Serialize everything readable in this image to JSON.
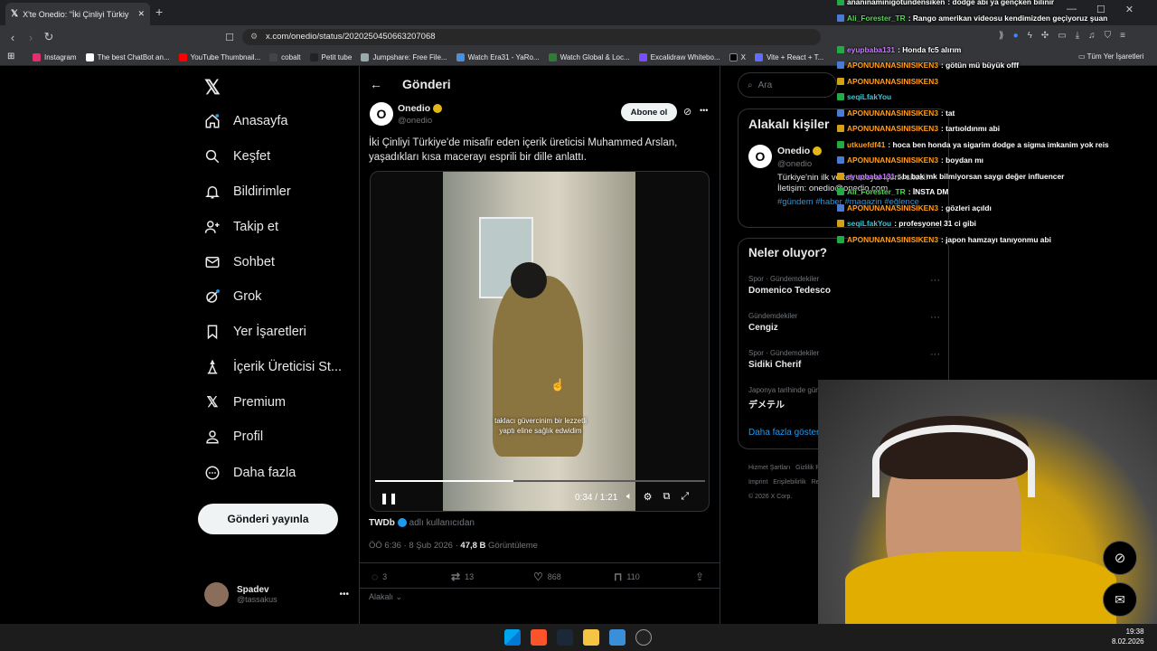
{
  "browser": {
    "tab_title": "X'te Onedio: \"İki Çinliyi Türkiy",
    "url": "x.com/onedio/status/2020250450663207068",
    "bookmarks": [
      "Instagram",
      "The best ChatBot an...",
      "YouTube Thumbnail...",
      "cobalt",
      "Petit tube",
      "Jumpshare: Free File...",
      "Watch Era31 - YaRo...",
      "Watch Global & Loc...",
      "Excalidraw Whitebo...",
      "X",
      "Vite + React + T..."
    ],
    "all_bookmarks": "Tüm Yer İşaretleri"
  },
  "sidebar": {
    "items": [
      {
        "label": "Anasayfa",
        "icon": "home-icon"
      },
      {
        "label": "Keşfet",
        "icon": "search-icon"
      },
      {
        "label": "Bildirimler",
        "icon": "bell-icon"
      },
      {
        "label": "Takip et",
        "icon": "add-user-icon"
      },
      {
        "label": "Sohbet",
        "icon": "mail-icon"
      },
      {
        "label": "Grok",
        "icon": "grok-icon"
      },
      {
        "label": "Yer İşaretleri",
        "icon": "bookmark-icon"
      },
      {
        "label": "İçerik Üreticisi St...",
        "icon": "creator-icon"
      },
      {
        "label": "Premium",
        "icon": "x-logo-icon"
      },
      {
        "label": "Profil",
        "icon": "person-icon"
      },
      {
        "label": "Daha fazla",
        "icon": "more-circle-icon"
      }
    ],
    "post_button": "Gönderi yayınla",
    "user_name": "Spadev",
    "user_handle": "@tassakus"
  },
  "post": {
    "header": "Gönderi",
    "author": "Onedio",
    "handle": "@onedio",
    "subscribe": "Abone ol",
    "text": "İki Çinliyi Türkiye'de misafir eden içerik üreticisi Muhammed Arslan, yaşadıkları kısa macerayı esprili bir dille anlattı.",
    "caption": "taklacı güvercinim bir lezzetli yaptı eline sağlık edwidim",
    "time_display": "0:34 / 1:21",
    "progress": 0.42,
    "source_name": "TWDb",
    "source_suffix": "adlı kullanıcıdan",
    "timestamp": "ÖÖ 6:36 · 8 Şub 2026 · ",
    "views": "47,8 B",
    "views_label": "Görüntüleme",
    "replies": "3",
    "reposts": "13",
    "likes": "868",
    "bookmarks": "110",
    "replies_sort": "Alakalı"
  },
  "right": {
    "search_placeholder": "Ara",
    "related_title": "Alakalı kişiler",
    "related_name": "Onedio",
    "related_handle": "@onedio",
    "related_bio": "Türkiye'nin ilk ve tek sosyal içerik sitesi! İletişim: onedio@onedio.com",
    "related_tags": "#gündem #haber #magazin #eğlence",
    "trends_title": "Neler oluyor?",
    "trends": [
      {
        "category": "Spor · Gündemdekiler",
        "name": "Domenico Tedesco"
      },
      {
        "category": "Gündemdekiler",
        "name": "Cengiz"
      },
      {
        "category": "Spor · Gündemdekiler",
        "name": "Sidiki Cherif"
      },
      {
        "category": "Japonya tarihinde gündemde",
        "name": "デメテル"
      }
    ],
    "show_more": "Daha fazla göster",
    "footer1": "Hizmet Şartları   Gizlilik Politikası   Çerez",
    "footer2": "Imprint   Erişilebilirlik   Reklam bilgisi",
    "footer3": "© 2026 X Corp."
  },
  "chat": [
    {
      "user": "ananinaminigötündensiken",
      "msg": "dodge abi ya gençken bilinir",
      "color": "#ffffff"
    },
    {
      "user": "Ali_Forester_TR",
      "msg": "Rango amerikan videosu kendimizden geçiyoruz şuan",
      "color": "#5ad45a"
    },
    {
      "user": "",
      "msg": "",
      "color": "#ffffff"
    },
    {
      "user": "eyupbaba131",
      "msg": "Honda fc5 alırım",
      "color": "#c77dff"
    },
    {
      "user": "APONUNANASINISIKEN3",
      "msg": "götün mü büyük offf",
      "color": "#ff9f1c"
    },
    {
      "user": "APONUNANASINISIKEN3",
      "msg": "",
      "color": "#ff9f1c"
    },
    {
      "user": "seqiLfakYou",
      "msg": "",
      "color": "#3ec1d3"
    },
    {
      "user": "APONUNANASINISIKEN3",
      "msg": "tat",
      "color": "#ff9f1c"
    },
    {
      "user": "APONUNANASINISIKEN3",
      "msg": "tartıoldınmı abi",
      "color": "#ff9f1c"
    },
    {
      "user": "utkuefdf41",
      "msg": "hoca ben honda ya sigarim dodge a sigma imkanim yok reis",
      "color": "#ff9f1c"
    },
    {
      "user": "APONUNANASINISIKEN3",
      "msg": "boydan mı",
      "color": "#ff9f1c"
    },
    {
      "user": "eyupbaba131",
      "msg": "bı bak mk bilmiyorsan saygı değer influencer",
      "color": "#c77dff"
    },
    {
      "user": "Ali_Forester_TR",
      "msg": "İNSTA DM",
      "color": "#5ad45a"
    },
    {
      "user": "APONUNANASINISIKEN3",
      "msg": "gözleri açıldı",
      "color": "#ff9f1c"
    },
    {
      "user": "seqiLfakYou",
      "msg": "profesyonel 31 ci gibi",
      "color": "#3ec1d3"
    },
    {
      "user": "APONUNANASINISIKEN3",
      "msg": "japon hamzayı tanıyonmu abi",
      "color": "#ff9f1c"
    }
  ],
  "taskbar": {
    "time": "19:38",
    "date": "8.02.2026"
  },
  "colors": {
    "accent": "#1d9bf0",
    "background": "#000000",
    "border": "#2f3336"
  }
}
